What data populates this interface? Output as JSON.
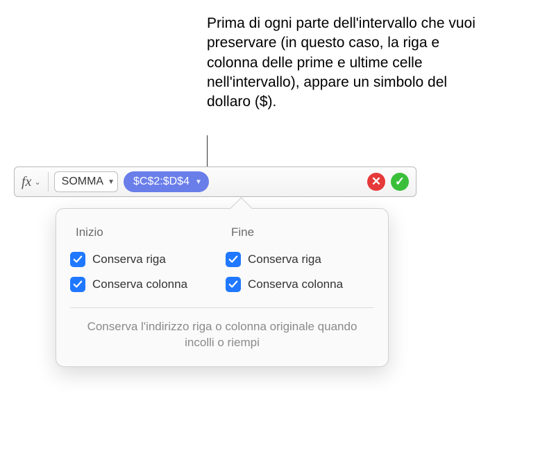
{
  "annotation": "Prima di ogni parte dell'intervallo che vuoi preservare (in questo caso, la riga e colonna delle prime e ultime celle nell'intervallo), appare un simbolo del dollaro ($).",
  "fx_label": "fx",
  "function_pill": "SOMMA",
  "range_pill": "$C$2:$D$4",
  "popover": {
    "start_heading": "Inizio",
    "end_heading": "Fine",
    "preserve_row": "Conserva riga",
    "preserve_col": "Conserva colonna",
    "hint": "Conserva l'indirizzo riga o colonna originale quando incolli o riempi"
  }
}
